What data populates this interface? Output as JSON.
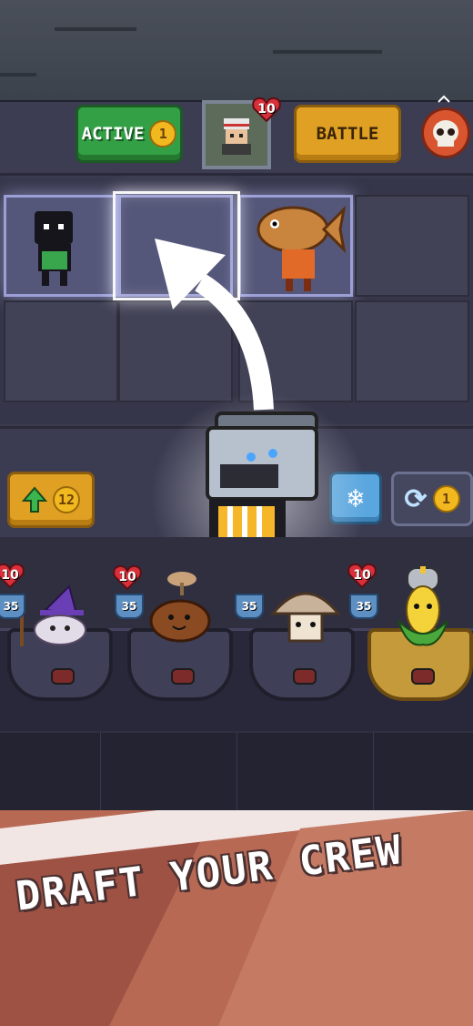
{
  "header": {
    "active_label": "ACTIVE",
    "active_count": "1",
    "battle_label": "BATTLE",
    "portrait_health": "10"
  },
  "shop": {
    "upgrade_cost": "12",
    "reroll_cost": "1"
  },
  "shop_units": [
    {
      "name": "wizard-onion",
      "health": "10",
      "attack": "35"
    },
    {
      "name": "potato-sprout",
      "health": "",
      "attack": "35"
    },
    {
      "name": "mushroom",
      "health": "10",
      "attack": "35"
    },
    {
      "name": "knight-corn",
      "health": "10",
      "attack": "35"
    }
  ],
  "tagline": "DRAFT YOUR CREW",
  "colors": {
    "active_green": "#33a046",
    "battle_gold": "#e0a023",
    "freeze_blue": "#5aa6de",
    "banner": "#b86954"
  }
}
